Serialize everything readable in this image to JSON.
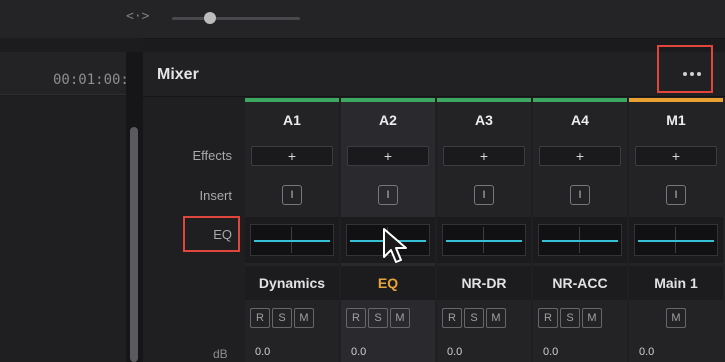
{
  "toolbar": {
    "zoom_icon_glyph": "<·>",
    "zoom_level": 0.3
  },
  "timeline": {
    "timecode": "00:01:00:"
  },
  "mixer": {
    "title": "Mixer",
    "row_labels": {
      "effects": "Effects",
      "insert": "Insert",
      "eq": "EQ",
      "db": "dB"
    },
    "channels": [
      {
        "name": "A1",
        "color": "#3aa860",
        "effects": "+",
        "insert": "I",
        "bus": "Dynamics",
        "buttons": [
          "R",
          "S",
          "M"
        ],
        "db": "0.0",
        "selected": false,
        "bus_active": false
      },
      {
        "name": "A2",
        "color": "#3aa860",
        "effects": "+",
        "insert": "I",
        "bus": "EQ",
        "buttons": [
          "R",
          "S",
          "M"
        ],
        "db": "0.0",
        "selected": true,
        "bus_active": true
      },
      {
        "name": "A3",
        "color": "#3aa860",
        "effects": "+",
        "insert": "I",
        "bus": "NR-DR",
        "buttons": [
          "R",
          "S",
          "M"
        ],
        "db": "0.0",
        "selected": false,
        "bus_active": false
      },
      {
        "name": "A4",
        "color": "#3aa860",
        "effects": "+",
        "insert": "I",
        "bus": "NR-ACC",
        "buttons": [
          "R",
          "S",
          "M"
        ],
        "db": "0.0",
        "selected": false,
        "bus_active": false
      },
      {
        "name": "M1",
        "color": "#e8a030",
        "effects": "+",
        "insert": "I",
        "bus": "Main 1",
        "buttons": [
          "M"
        ],
        "db": "0.0",
        "selected": false,
        "bus_active": false
      }
    ]
  },
  "colors": {
    "highlight": "#e0463c",
    "accent_bus": "#e6a43a",
    "eq_curve": "#35c0d6"
  }
}
